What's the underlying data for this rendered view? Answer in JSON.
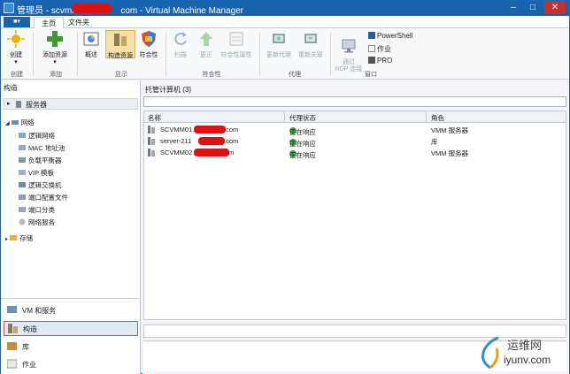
{
  "window": {
    "title": "管理员 - scvmm.",
    "title_suffix": "com - Virtual Machine Manager",
    "min": "–",
    "max": "□",
    "close": "✕"
  },
  "menu": {
    "file_label": "■▾",
    "tabs": [
      "主页",
      "文件夹"
    ]
  },
  "ribbon": {
    "buttons": {
      "create": "创建",
      "add_resource": "添加资源",
      "overview": "概述",
      "fabric_resource": "构造资源",
      "compliance": "符合性",
      "scan": "扫描",
      "remediate": "更正",
      "compliance_properties": "符合性属性",
      "update_agent": "更新代理",
      "reassociate": "重新关联",
      "rdp": "通过\nRDP 连接"
    },
    "small_items": [
      "PowerShell",
      "作业",
      "PRO"
    ],
    "groups": [
      "创建",
      "添加",
      "显示",
      "符合性",
      "代理",
      "窗口"
    ]
  },
  "left": {
    "header": "构造",
    "servers": "服务器",
    "networking": "网络",
    "network_items": [
      "逻辑网络",
      "MAC 地址池",
      "负载平衡器",
      "VIP 模板",
      "逻辑交换机",
      "端口配置文件",
      "端口分类",
      "网络服务"
    ],
    "storage": "存储",
    "nav": [
      "VM 和服务",
      "构造",
      "库",
      "作业"
    ]
  },
  "main": {
    "header": "托管计算机 (3)",
    "columns": [
      "名称",
      "代理状态",
      "角色"
    ],
    "rows": [
      {
        "name_a": "SCVMM01.",
        "name_b": ".com",
        "status": "正在响应",
        "role": "VMM 服务器"
      },
      {
        "name_a": "server-211",
        "name_b": ".com",
        "status": "正在响应",
        "role": "库"
      },
      {
        "name_a": "SCVMM02.",
        "name_b": "m",
        "status": "正在响应",
        "role": "VMM 服务器"
      }
    ]
  },
  "watermark": {
    "cn": "运维网",
    "url": "iyunv.com"
  },
  "colors": {
    "accent": "#1a63ad",
    "redact": "#e01010",
    "ok": "#3ba640",
    "selected_border": "#d94a4a"
  }
}
